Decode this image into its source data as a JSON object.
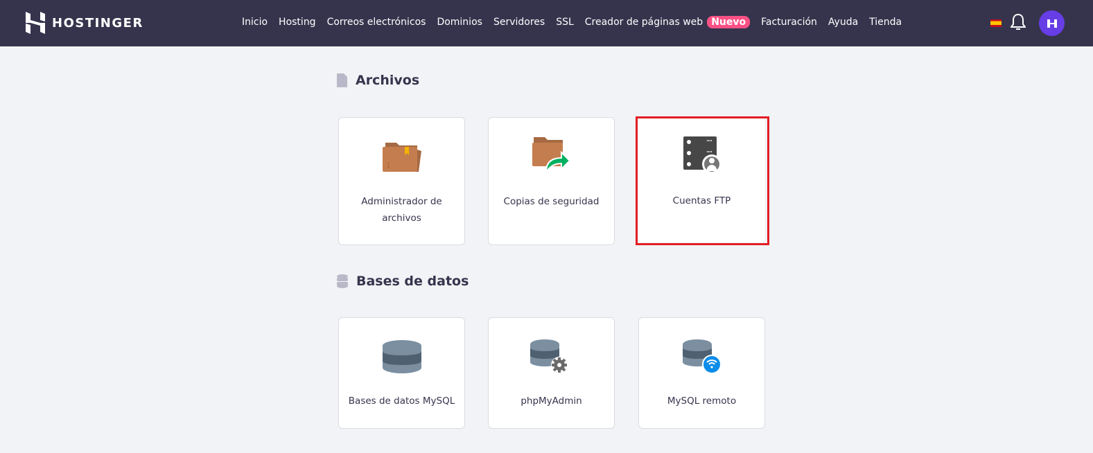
{
  "header": {
    "brand": "HOSTINGER",
    "nav": [
      "Inicio",
      "Hosting",
      "Correos electrónicos",
      "Dominios",
      "Servidores",
      "SSL",
      "Creador de páginas web",
      "Facturación",
      "Ayuda",
      "Tienda"
    ],
    "new_badge": "Nuevo",
    "language": "es",
    "badge_color": "#fc5185"
  },
  "sections": [
    {
      "title": "Archivos",
      "cards": [
        {
          "label": "Administrador de archivos",
          "icon": "folder-icon"
        },
        {
          "label": "Copias de seguridad",
          "icon": "folder-backup-icon"
        },
        {
          "label": "Cuentas FTP",
          "icon": "ftp-server-user-icon",
          "highlighted": true
        }
      ]
    },
    {
      "title": "Bases de datos",
      "cards": [
        {
          "label": "Bases de datos MySQL",
          "icon": "database-icon"
        },
        {
          "label": "phpMyAdmin",
          "icon": "database-gear-icon"
        },
        {
          "label": "MySQL remoto",
          "icon": "database-wifi-icon"
        }
      ]
    }
  ],
  "highlight_color": "#e41c24"
}
